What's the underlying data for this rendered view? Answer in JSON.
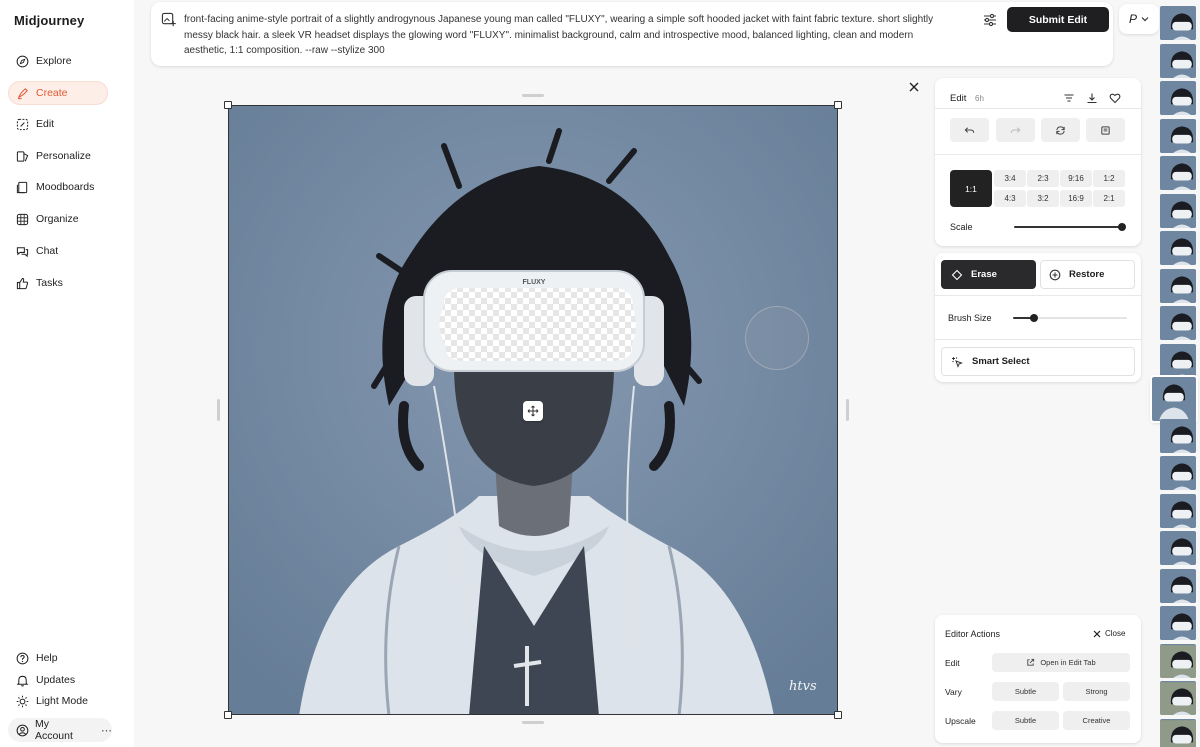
{
  "app": {
    "title": "Midjourney"
  },
  "sidebar": {
    "items": [
      {
        "label": "Explore",
        "icon": "compass-icon"
      },
      {
        "label": "Create",
        "icon": "brush-icon"
      },
      {
        "label": "Edit",
        "icon": "edit-frame-icon"
      },
      {
        "label": "Personalize",
        "icon": "personalize-icon"
      },
      {
        "label": "Moodboards",
        "icon": "moodboard-icon"
      },
      {
        "label": "Organize",
        "icon": "grid-icon"
      },
      {
        "label": "Chat",
        "icon": "chat-icon"
      },
      {
        "label": "Tasks",
        "icon": "thumbs-up-icon"
      }
    ],
    "bottom": [
      {
        "label": "Help",
        "icon": "help-icon"
      },
      {
        "label": "Updates",
        "icon": "bell-icon"
      },
      {
        "label": "Light Mode",
        "icon": "sun-icon"
      }
    ],
    "account_label": "My Account",
    "account_more": "⋯"
  },
  "prompt": {
    "text": "front-facing anime-style portrait of a slightly androgynous Japanese young man called \"FLUXY\", wearing a simple soft hooded jacket with faint fabric texture. short slightly messy black hair. a sleek VR headset displays the glowing word \"FLUXY\". minimalist background, calm and introspective mood, balanced lighting, clean and modern aesthetic, 1:1 composition. --raw --stylize 300",
    "submit_label": "Submit Edit",
    "profile_letter": "P"
  },
  "canvas": {
    "headset_text": "FLUXY",
    "signature": "htvs"
  },
  "edit_panel": {
    "title": "Edit",
    "age": "6h",
    "ratios_top": [
      "3:4",
      "2:3",
      "9:16",
      "1:2"
    ],
    "ratios_bottom": [
      "4:3",
      "3:2",
      "16:9",
      "2:1"
    ],
    "ratio_selected": "1:1",
    "scale_label": "Scale",
    "scale_value": 1.0
  },
  "brush_panel": {
    "erase_label": "Erase",
    "restore_label": "Restore",
    "brush_size_label": "Brush Size",
    "brush_size_value": 0.18,
    "smart_select_label": "Smart Select"
  },
  "actions_panel": {
    "title": "Editor Actions",
    "close_label": "Close",
    "edit_label": "Edit",
    "open_edit_tab": "Open in Edit Tab",
    "vary_label": "Vary",
    "vary_subtle": "Subtle",
    "vary_strong": "Strong",
    "upscale_label": "Upscale",
    "upscale_subtle": "Subtle",
    "upscale_creative": "Creative"
  },
  "colors": {
    "accent": "#e05a33",
    "dark_button": "#1f1f22",
    "image_bg": "#6f86a0"
  }
}
